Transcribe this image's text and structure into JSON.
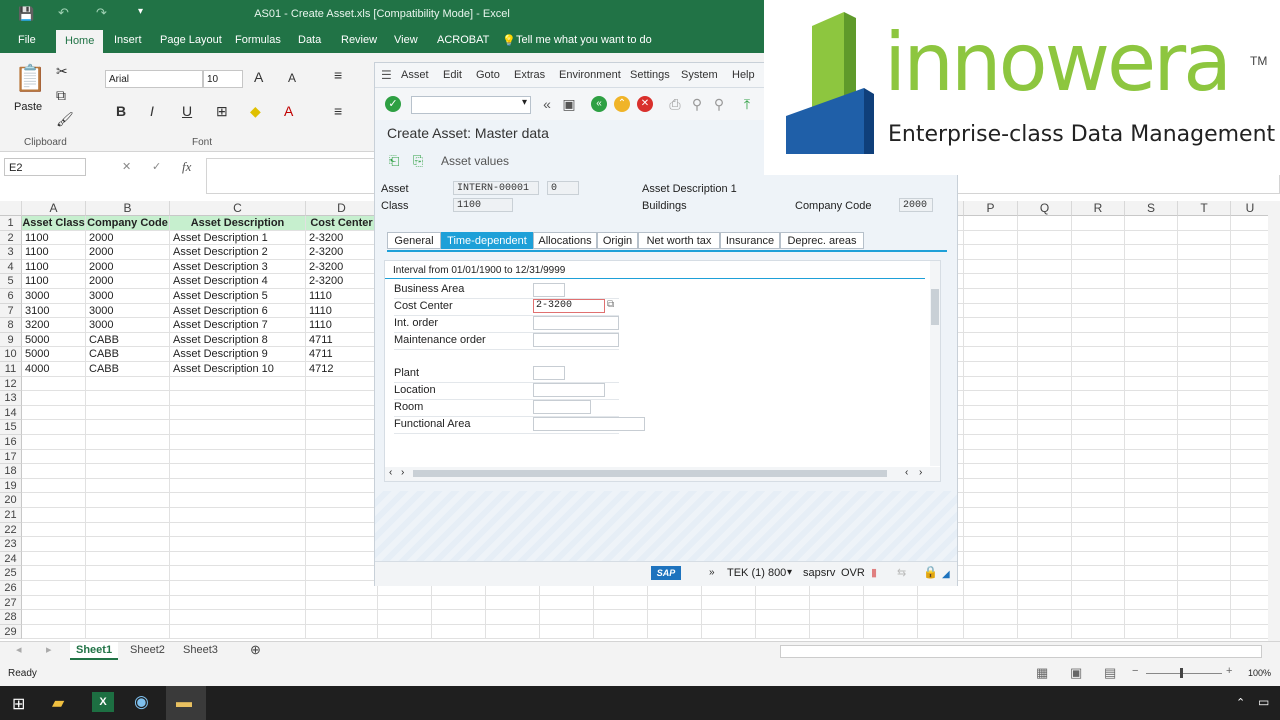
{
  "excel": {
    "title": "AS01 - Create Asset.xls  [Compatibility Mode]  -  Excel",
    "tabs": [
      "File",
      "Home",
      "Insert",
      "Page Layout",
      "Formulas",
      "Data",
      "Review",
      "View",
      "ACROBAT"
    ],
    "tell_me": "Tell me what you want to do",
    "font_name": "Arial",
    "font_size": "10",
    "paste_label": "Paste",
    "group_clipboard": "Clipboard",
    "group_font": "Font",
    "name_box": "E2",
    "fx": "fx",
    "columns": [
      "A",
      "B",
      "C",
      "D",
      "P",
      "Q",
      "R",
      "S",
      "T",
      "U"
    ],
    "header_row": [
      "Asset Class",
      "Company Code",
      "Asset Description",
      "Cost Center"
    ],
    "rows": [
      [
        "1100",
        "2000",
        "Asset Description 1",
        "2-3200"
      ],
      [
        "1100",
        "2000",
        "Asset Description 2",
        "2-3200"
      ],
      [
        "1100",
        "2000",
        "Asset Description 3",
        "2-3200"
      ],
      [
        "1100",
        "2000",
        "Asset Description 4",
        "2-3200"
      ],
      [
        "3000",
        "3000",
        "Asset Description 5",
        "1110"
      ],
      [
        "3100",
        "3000",
        "Asset Description 6",
        "1110"
      ],
      [
        "3200",
        "3000",
        "Asset Description 7",
        "1110"
      ],
      [
        "5000",
        "CABB",
        "Asset Description 8",
        "4711"
      ],
      [
        "5000",
        "CABB",
        "Asset Description 9",
        "4711"
      ],
      [
        "4000",
        "CABB",
        "Asset Description 10",
        "4712"
      ]
    ],
    "row_numbers": [
      "1",
      "2",
      "3",
      "4",
      "5",
      "6",
      "7",
      "8",
      "9",
      "10",
      "11",
      "12",
      "13",
      "14",
      "15",
      "16",
      "17",
      "18",
      "19",
      "20",
      "21",
      "22",
      "23",
      "24",
      "25",
      "26",
      "27",
      "28",
      "29"
    ],
    "sheets": [
      "Sheet1",
      "Sheet2",
      "Sheet3"
    ],
    "status": "Ready",
    "zoom": "100%"
  },
  "sap": {
    "menu": [
      "Asset",
      "Edit",
      "Goto",
      "Extras",
      "Environment",
      "Settings",
      "System",
      "Help"
    ],
    "title": "Create Asset:  Master data",
    "asset_values": "Asset values",
    "asset_label": "Asset",
    "asset_value": "INTERN-00001",
    "asset_sub": "0",
    "asset_desc": "Asset Description 1",
    "class_label": "Class",
    "class_value": "1100",
    "class_desc": "Buildings",
    "company_label": "Company Code",
    "company_value": "2000",
    "tabs": [
      "General",
      "Time-dependent",
      "Allocations",
      "Origin",
      "Net worth tax",
      "Insurance",
      "Deprec. areas"
    ],
    "interval": "Interval from 01/01/1900 to 12/31/9999",
    "fields": [
      {
        "label": "Business Area",
        "value": ""
      },
      {
        "label": "Cost Center",
        "value": "2-3200"
      },
      {
        "label": "Int. order",
        "value": ""
      },
      {
        "label": "Maintenance order",
        "value": ""
      },
      {
        "label": "Plant",
        "value": ""
      },
      {
        "label": "Location",
        "value": ""
      },
      {
        "label": "Room",
        "value": ""
      },
      {
        "label": "Functional Area",
        "value": ""
      }
    ],
    "status_system": "TEK (1) 800",
    "status_server": "sapsrv",
    "status_mode": "OVR",
    "sap_logo": "SAP"
  },
  "brand": {
    "name": "innowera",
    "tm": "TM",
    "tagline": "Enterprise-class Data Management",
    "green": "#8dc63f",
    "blue": "#1f5fa8"
  }
}
